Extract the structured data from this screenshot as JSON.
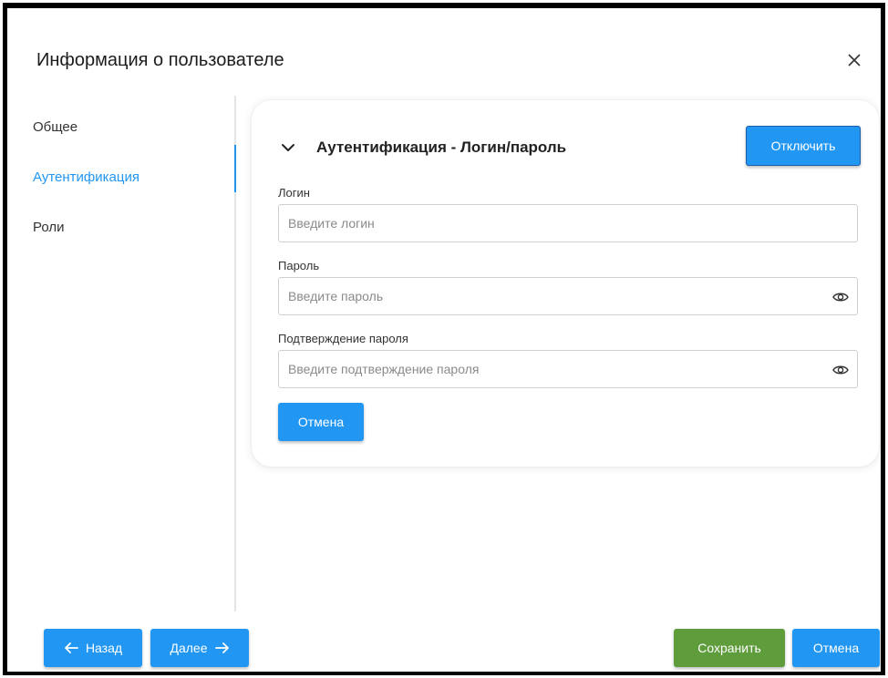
{
  "dialog": {
    "title": "Информация о пользователе",
    "close_icon": "close-icon"
  },
  "sidebar": {
    "items": [
      {
        "label": "Общее",
        "active": false
      },
      {
        "label": "Аутентификация",
        "active": true
      },
      {
        "label": "Роли",
        "active": false
      }
    ]
  },
  "auth_section": {
    "title": "Аутентификация - Логин/пароль",
    "expand_icon": "chevron-down-icon",
    "disable_label": "Отключить",
    "login": {
      "label": "Логин",
      "placeholder": "Введите логин",
      "value": ""
    },
    "password": {
      "label": "Пароль",
      "placeholder": "Введите пароль",
      "value": "",
      "icon": "eye-icon"
    },
    "confirm": {
      "label": "Подтверждение пароля",
      "placeholder": "Введите подтверждение пароля",
      "value": "",
      "icon": "eye-icon"
    },
    "cancel_label": "Отмена"
  },
  "footer": {
    "back_label": "Назад",
    "next_label": "Далее",
    "save_label": "Сохранить",
    "cancel_label": "Отмена"
  },
  "colors": {
    "accent": "#2196f3",
    "save": "#5f9d3c",
    "border": "#000000"
  }
}
